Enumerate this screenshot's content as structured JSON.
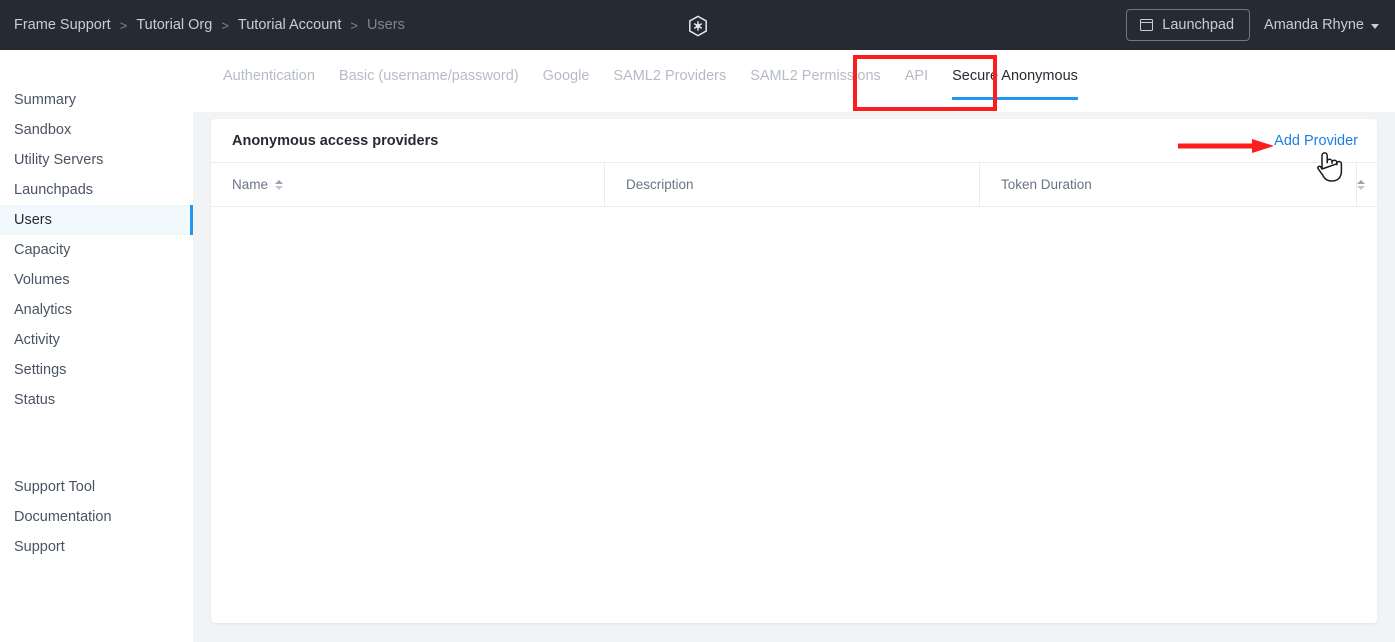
{
  "header": {
    "breadcrumb": [
      {
        "label": "Frame Support",
        "current": false
      },
      {
        "label": "Tutorial Org",
        "current": false
      },
      {
        "label": "Tutorial Account",
        "current": false
      },
      {
        "label": "Users",
        "current": true
      }
    ],
    "separator": ">",
    "logo_icon": "cube-logo-icon",
    "launchpad_button": {
      "label": "Launchpad",
      "icon": "window-icon"
    },
    "user_menu": {
      "label": "Amanda Rhyne",
      "icon": "chevron-down-icon"
    },
    "background_color": "#262b33"
  },
  "sidebar": {
    "primary_items": [
      {
        "label": "Summary",
        "active": false
      },
      {
        "label": "Sandbox",
        "active": false
      },
      {
        "label": "Utility Servers",
        "active": false
      },
      {
        "label": "Launchpads",
        "active": false
      },
      {
        "label": "Users",
        "active": true
      },
      {
        "label": "Capacity",
        "active": false
      },
      {
        "label": "Volumes",
        "active": false
      },
      {
        "label": "Analytics",
        "active": false
      },
      {
        "label": "Activity",
        "active": false
      },
      {
        "label": "Settings",
        "active": false
      },
      {
        "label": "Status",
        "active": false
      }
    ],
    "secondary_items": [
      {
        "label": "Support Tool"
      },
      {
        "label": "Documentation"
      },
      {
        "label": "Support"
      }
    ],
    "active_accent_color": "#2196f3",
    "active_background_color": "#f2f9fd"
  },
  "tabs": {
    "items": [
      {
        "label": "Authentication",
        "active": false
      },
      {
        "label": "Basic (username/password)",
        "active": false
      },
      {
        "label": "Google",
        "active": false
      },
      {
        "label": "SAML2 Providers",
        "active": false
      },
      {
        "label": "SAML2 Permissions",
        "active": false
      },
      {
        "label": "API",
        "active": false
      },
      {
        "label": "Secure Anonymous",
        "active": true
      }
    ],
    "active_underline_color": "#2196f3",
    "inactive_color": "#b6bcc6"
  },
  "card": {
    "title": "Anonymous access providers",
    "add_provider_label": "Add Provider",
    "add_provider_color": "#1b7fe0",
    "table": {
      "columns": [
        {
          "label": "Name",
          "sortable": true
        },
        {
          "label": "Description",
          "sortable": false
        },
        {
          "label": "Token Duration",
          "sortable": false
        },
        {
          "label": "",
          "sortable": true
        }
      ],
      "rows": []
    }
  },
  "annotations": {
    "tab_highlight_box_color": "#fc1d1d",
    "arrow_color": "#fc1d1d",
    "arrow_target": "Add Provider",
    "cursor_icon": "pointing-hand-cursor"
  },
  "page_background_color": "#f1f3f5"
}
